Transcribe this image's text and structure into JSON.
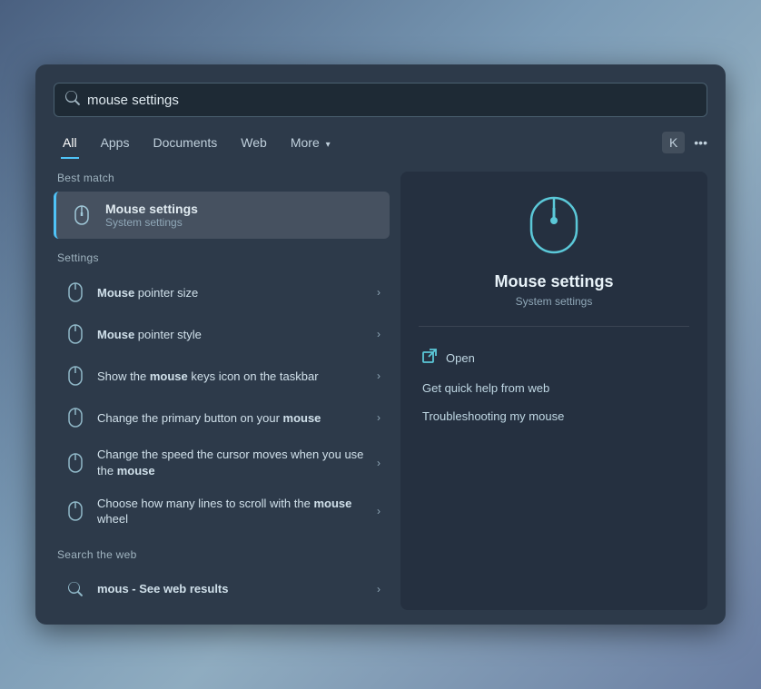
{
  "background": {
    "color": "#6b7fa3"
  },
  "search": {
    "placeholder": "mouse settings",
    "value": "mouse settings"
  },
  "tabs": [
    {
      "id": "all",
      "label": "All",
      "active": true
    },
    {
      "id": "apps",
      "label": "Apps",
      "active": false
    },
    {
      "id": "documents",
      "label": "Documents",
      "active": false
    },
    {
      "id": "web",
      "label": "Web",
      "active": false
    },
    {
      "id": "more",
      "label": "More",
      "active": false
    }
  ],
  "tabs_right": {
    "user_initial": "K"
  },
  "best_match": {
    "section_label": "Best match",
    "title_plain": " settings",
    "title_bold": "Mouse",
    "subtitle": "System settings"
  },
  "settings_section": {
    "label": "Settings",
    "items": [
      {
        "title_plain": " pointer size",
        "title_bold": "Mouse",
        "has_arrow": true
      },
      {
        "title_plain": " pointer style",
        "title_bold": "Mouse",
        "has_arrow": true
      },
      {
        "title_plain": "Show the ",
        "title_bold": "mouse",
        "title_suffix": " keys icon on the taskbar",
        "has_arrow": true
      },
      {
        "title_plain": "Change the primary button on your ",
        "title_bold": "mouse",
        "title_suffix": "",
        "has_arrow": true
      },
      {
        "title_plain": "Change the speed the cursor moves when you use the ",
        "title_bold": "mouse",
        "title_suffix": "",
        "has_arrow": true
      },
      {
        "title_plain": "Choose how many lines to scroll with the ",
        "title_bold": "mouse",
        "title_suffix": " wheel",
        "has_arrow": true
      }
    ]
  },
  "web_search": {
    "section_label": "Search the web",
    "query_plain": "mous",
    "query_suffix": " - See web results",
    "has_arrow": true
  },
  "right_panel": {
    "title_bold": "Mouse",
    "title_suffix": " settings",
    "subtitle": "System settings",
    "open_label": "Open",
    "quick_help_label": "Get quick help from web",
    "troubleshoot_label": "Troubleshooting my mouse"
  }
}
